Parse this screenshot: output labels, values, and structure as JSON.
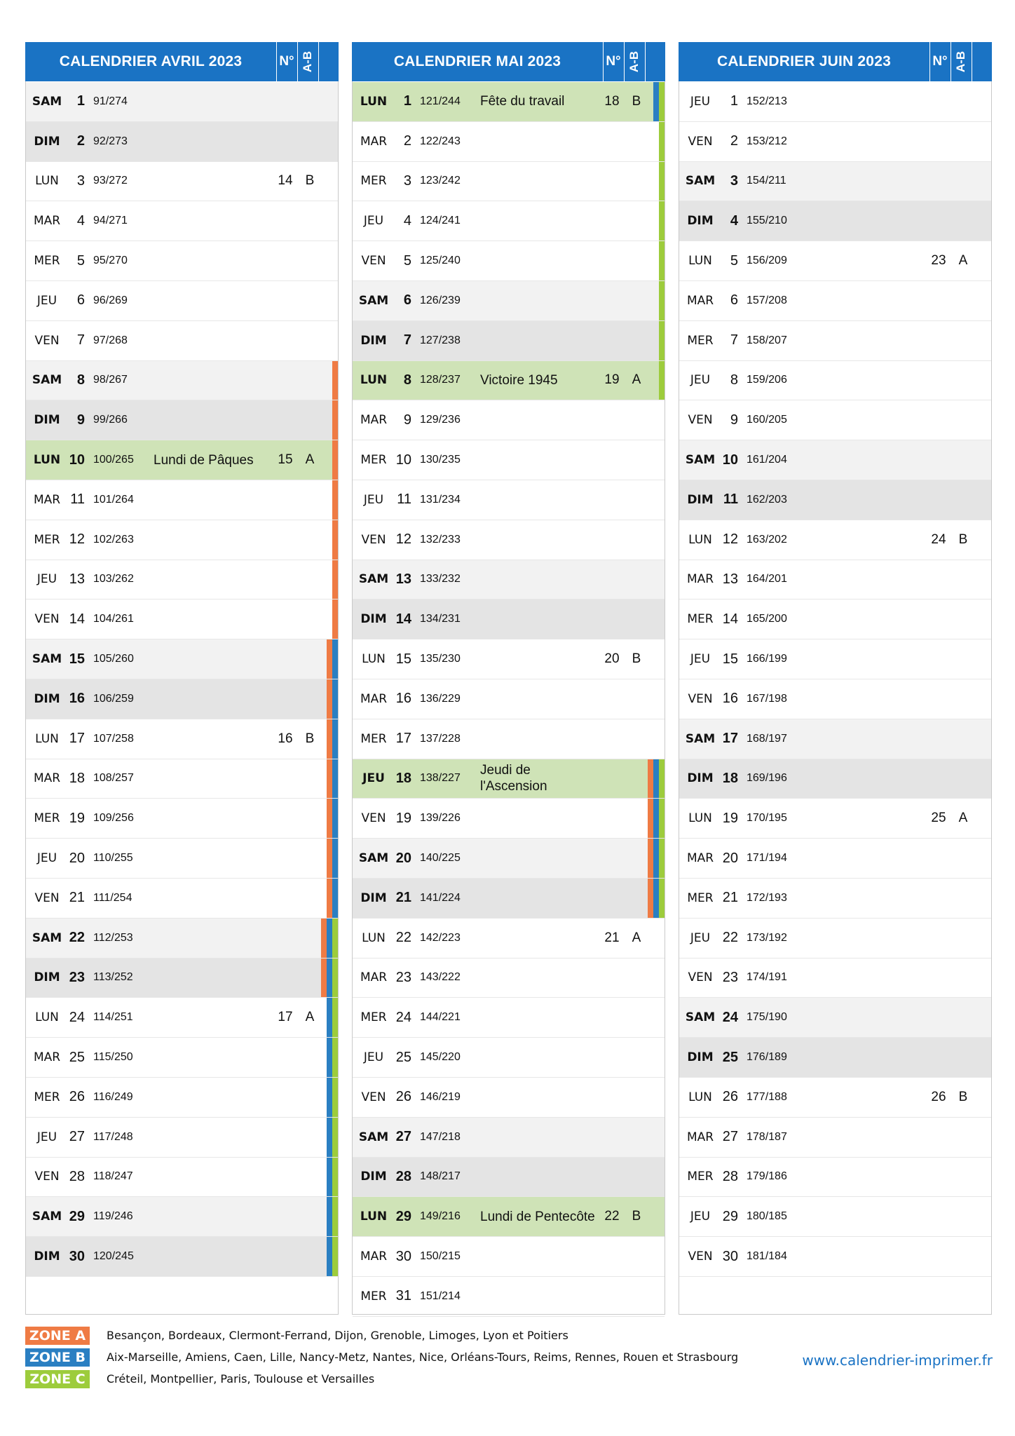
{
  "colors": {
    "header": "#1a73c4",
    "zone_a": "#ef7b44",
    "zone_b": "#2a7fc2",
    "zone_c": "#9dcc3c",
    "holiday": "#cfe3b7"
  },
  "header_labels": {
    "week": "N°",
    "ab": "A-B"
  },
  "months": [
    {
      "title": "CALENDRIER AVRIL 2023",
      "days": [
        {
          "d": "SAM",
          "n": "1",
          "y": "91/274",
          "t": "sat"
        },
        {
          "d": "DIM",
          "n": "2",
          "y": "92/273",
          "t": "sun"
        },
        {
          "d": "LUN",
          "n": "3",
          "y": "93/272",
          "w": "14",
          "ab": "B"
        },
        {
          "d": "MAR",
          "n": "4",
          "y": "94/271"
        },
        {
          "d": "MER",
          "n": "5",
          "y": "95/270"
        },
        {
          "d": "JEU",
          "n": "6",
          "y": "96/269"
        },
        {
          "d": "VEN",
          "n": "7",
          "y": "97/268"
        },
        {
          "d": "SAM",
          "n": "8",
          "y": "98/267",
          "t": "sat",
          "z": [
            "A"
          ]
        },
        {
          "d": "DIM",
          "n": "9",
          "y": "99/266",
          "t": "sun",
          "z": [
            "A"
          ]
        },
        {
          "d": "LUN",
          "n": "10",
          "y": "100/265",
          "t": "hol",
          "h": "Lundi de Pâques",
          "w": "15",
          "ab": "A",
          "z": [
            "A"
          ]
        },
        {
          "d": "MAR",
          "n": "11",
          "y": "101/264",
          "z": [
            "A"
          ]
        },
        {
          "d": "MER",
          "n": "12",
          "y": "102/263",
          "z": [
            "A"
          ]
        },
        {
          "d": "JEU",
          "n": "13",
          "y": "103/262",
          "z": [
            "A"
          ]
        },
        {
          "d": "VEN",
          "n": "14",
          "y": "104/261",
          "z": [
            "A"
          ]
        },
        {
          "d": "SAM",
          "n": "15",
          "y": "105/260",
          "t": "sat",
          "z": [
            "A",
            "B"
          ]
        },
        {
          "d": "DIM",
          "n": "16",
          "y": "106/259",
          "t": "sun",
          "z": [
            "A",
            "B"
          ]
        },
        {
          "d": "LUN",
          "n": "17",
          "y": "107/258",
          "w": "16",
          "ab": "B",
          "z": [
            "A",
            "B"
          ]
        },
        {
          "d": "MAR",
          "n": "18",
          "y": "108/257",
          "z": [
            "A",
            "B"
          ]
        },
        {
          "d": "MER",
          "n": "19",
          "y": "109/256",
          "z": [
            "A",
            "B"
          ]
        },
        {
          "d": "JEU",
          "n": "20",
          "y": "110/255",
          "z": [
            "A",
            "B"
          ]
        },
        {
          "d": "VEN",
          "n": "21",
          "y": "111/254",
          "z": [
            "A",
            "B"
          ]
        },
        {
          "d": "SAM",
          "n": "22",
          "y": "112/253",
          "t": "sat",
          "z": [
            "A",
            "B",
            "C"
          ]
        },
        {
          "d": "DIM",
          "n": "23",
          "y": "113/252",
          "t": "sun",
          "z": [
            "A",
            "B",
            "C"
          ]
        },
        {
          "d": "LUN",
          "n": "24",
          "y": "114/251",
          "w": "17",
          "ab": "A",
          "z": [
            "B",
            "C"
          ]
        },
        {
          "d": "MAR",
          "n": "25",
          "y": "115/250",
          "z": [
            "B",
            "C"
          ]
        },
        {
          "d": "MER",
          "n": "26",
          "y": "116/249",
          "z": [
            "B",
            "C"
          ]
        },
        {
          "d": "JEU",
          "n": "27",
          "y": "117/248",
          "z": [
            "B",
            "C"
          ]
        },
        {
          "d": "VEN",
          "n": "28",
          "y": "118/247",
          "z": [
            "B",
            "C"
          ]
        },
        {
          "d": "SAM",
          "n": "29",
          "y": "119/246",
          "t": "sat",
          "z": [
            "B",
            "C"
          ]
        },
        {
          "d": "DIM",
          "n": "30",
          "y": "120/245",
          "t": "sun",
          "z": [
            "B",
            "C"
          ]
        }
      ]
    },
    {
      "title": "CALENDRIER MAI 2023",
      "days": [
        {
          "d": "LUN",
          "n": "1",
          "y": "121/244",
          "t": "hol",
          "h": "Fête du travail",
          "w": "18",
          "ab": "B",
          "z": [
            "B",
            "C"
          ]
        },
        {
          "d": "MAR",
          "n": "2",
          "y": "122/243",
          "z": [
            "C"
          ]
        },
        {
          "d": "MER",
          "n": "3",
          "y": "123/242",
          "z": [
            "C"
          ]
        },
        {
          "d": "JEU",
          "n": "4",
          "y": "124/241",
          "z": [
            "C"
          ]
        },
        {
          "d": "VEN",
          "n": "5",
          "y": "125/240",
          "z": [
            "C"
          ]
        },
        {
          "d": "SAM",
          "n": "6",
          "y": "126/239",
          "t": "sat",
          "z": [
            "C"
          ]
        },
        {
          "d": "DIM",
          "n": "7",
          "y": "127/238",
          "t": "sun",
          "z": [
            "C"
          ]
        },
        {
          "d": "LUN",
          "n": "8",
          "y": "128/237",
          "t": "hol",
          "h": "Victoire 1945",
          "w": "19",
          "ab": "A",
          "z": [
            "C"
          ]
        },
        {
          "d": "MAR",
          "n": "9",
          "y": "129/236"
        },
        {
          "d": "MER",
          "n": "10",
          "y": "130/235"
        },
        {
          "d": "JEU",
          "n": "11",
          "y": "131/234"
        },
        {
          "d": "VEN",
          "n": "12",
          "y": "132/233"
        },
        {
          "d": "SAM",
          "n": "13",
          "y": "133/232",
          "t": "sat"
        },
        {
          "d": "DIM",
          "n": "14",
          "y": "134/231",
          "t": "sun"
        },
        {
          "d": "LUN",
          "n": "15",
          "y": "135/230",
          "w": "20",
          "ab": "B"
        },
        {
          "d": "MAR",
          "n": "16",
          "y": "136/229"
        },
        {
          "d": "MER",
          "n": "17",
          "y": "137/228"
        },
        {
          "d": "JEU",
          "n": "18",
          "y": "138/227",
          "t": "hol",
          "h": "Jeudi de l'Ascension",
          "z": [
            "A",
            "B",
            "C"
          ]
        },
        {
          "d": "VEN",
          "n": "19",
          "y": "139/226",
          "z": [
            "A",
            "B",
            "C"
          ]
        },
        {
          "d": "SAM",
          "n": "20",
          "y": "140/225",
          "t": "sat",
          "z": [
            "A",
            "B",
            "C"
          ]
        },
        {
          "d": "DIM",
          "n": "21",
          "y": "141/224",
          "t": "sun",
          "z": [
            "A",
            "B",
            "C"
          ]
        },
        {
          "d": "LUN",
          "n": "22",
          "y": "142/223",
          "w": "21",
          "ab": "A"
        },
        {
          "d": "MAR",
          "n": "23",
          "y": "143/222"
        },
        {
          "d": "MER",
          "n": "24",
          "y": "144/221"
        },
        {
          "d": "JEU",
          "n": "25",
          "y": "145/220"
        },
        {
          "d": "VEN",
          "n": "26",
          "y": "146/219"
        },
        {
          "d": "SAM",
          "n": "27",
          "y": "147/218",
          "t": "sat"
        },
        {
          "d": "DIM",
          "n": "28",
          "y": "148/217",
          "t": "sun"
        },
        {
          "d": "LUN",
          "n": "29",
          "y": "149/216",
          "t": "hol",
          "h": "Lundi de Pentecôte",
          "w": "22",
          "ab": "B"
        },
        {
          "d": "MAR",
          "n": "30",
          "y": "150/215"
        },
        {
          "d": "MER",
          "n": "31",
          "y": "151/214"
        }
      ]
    },
    {
      "title": "CALENDRIER JUIN 2023",
      "days": [
        {
          "d": "JEU",
          "n": "1",
          "y": "152/213"
        },
        {
          "d": "VEN",
          "n": "2",
          "y": "153/212"
        },
        {
          "d": "SAM",
          "n": "3",
          "y": "154/211",
          "t": "sat"
        },
        {
          "d": "DIM",
          "n": "4",
          "y": "155/210",
          "t": "sun"
        },
        {
          "d": "LUN",
          "n": "5",
          "y": "156/209",
          "w": "23",
          "ab": "A"
        },
        {
          "d": "MAR",
          "n": "6",
          "y": "157/208"
        },
        {
          "d": "MER",
          "n": "7",
          "y": "158/207"
        },
        {
          "d": "JEU",
          "n": "8",
          "y": "159/206"
        },
        {
          "d": "VEN",
          "n": "9",
          "y": "160/205"
        },
        {
          "d": "SAM",
          "n": "10",
          "y": "161/204",
          "t": "sat"
        },
        {
          "d": "DIM",
          "n": "11",
          "y": "162/203",
          "t": "sun"
        },
        {
          "d": "LUN",
          "n": "12",
          "y": "163/202",
          "w": "24",
          "ab": "B"
        },
        {
          "d": "MAR",
          "n": "13",
          "y": "164/201"
        },
        {
          "d": "MER",
          "n": "14",
          "y": "165/200"
        },
        {
          "d": "JEU",
          "n": "15",
          "y": "166/199"
        },
        {
          "d": "VEN",
          "n": "16",
          "y": "167/198"
        },
        {
          "d": "SAM",
          "n": "17",
          "y": "168/197",
          "t": "sat"
        },
        {
          "d": "DIM",
          "n": "18",
          "y": "169/196",
          "t": "sun"
        },
        {
          "d": "LUN",
          "n": "19",
          "y": "170/195",
          "w": "25",
          "ab": "A"
        },
        {
          "d": "MAR",
          "n": "20",
          "y": "171/194"
        },
        {
          "d": "MER",
          "n": "21",
          "y": "172/193"
        },
        {
          "d": "JEU",
          "n": "22",
          "y": "173/192"
        },
        {
          "d": "VEN",
          "n": "23",
          "y": "174/191"
        },
        {
          "d": "SAM",
          "n": "24",
          "y": "175/190",
          "t": "sat"
        },
        {
          "d": "DIM",
          "n": "25",
          "y": "176/189",
          "t": "sun"
        },
        {
          "d": "LUN",
          "n": "26",
          "y": "177/188",
          "w": "26",
          "ab": "B"
        },
        {
          "d": "MAR",
          "n": "27",
          "y": "178/187"
        },
        {
          "d": "MER",
          "n": "28",
          "y": "179/186"
        },
        {
          "d": "JEU",
          "n": "29",
          "y": "180/185"
        },
        {
          "d": "VEN",
          "n": "30",
          "y": "181/184"
        }
      ]
    }
  ],
  "legend": {
    "zones": [
      {
        "label": "ZONE A",
        "text": "Besançon, Bordeaux, Clermont-Ferrand, Dijon, Grenoble, Limoges, Lyon et Poitiers",
        "color": "#ef7b44"
      },
      {
        "label": "ZONE B",
        "text": "Aix-Marseille, Amiens, Caen, Lille, Nancy-Metz, Nantes, Nice, Orléans-Tours, Reims, Rennes, Rouen et Strasbourg",
        "color": "#2a7fc2"
      },
      {
        "label": "ZONE C",
        "text": "Créteil, Montpellier, Paris, Toulouse et Versailles",
        "color": "#9dcc3c"
      }
    ],
    "website": "www.calendrier-imprimer.fr"
  }
}
